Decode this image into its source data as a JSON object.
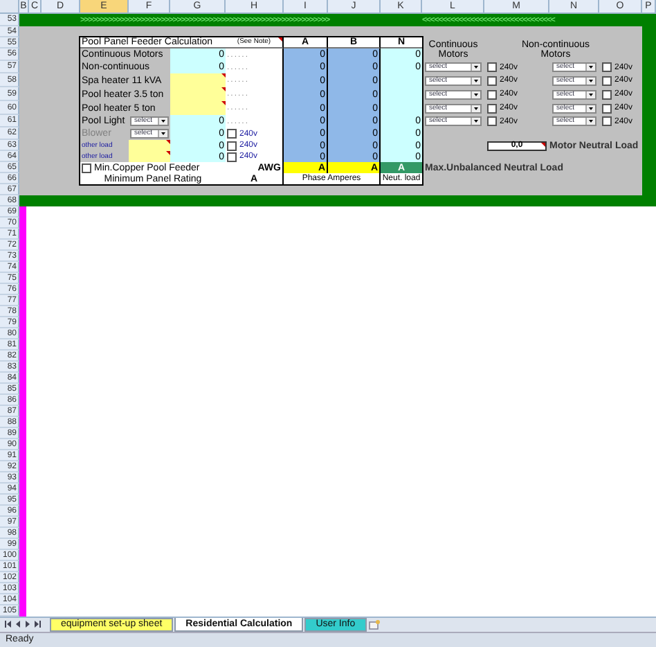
{
  "columns": [
    {
      "label": "B",
      "selected": false
    },
    {
      "label": "C",
      "selected": false
    },
    {
      "label": "D",
      "selected": false
    },
    {
      "label": "E",
      "selected": true
    },
    {
      "label": "F",
      "selected": false
    },
    {
      "label": "G",
      "selected": false
    },
    {
      "label": "H",
      "selected": false
    },
    {
      "label": "I",
      "selected": false
    },
    {
      "label": "J",
      "selected": false
    },
    {
      "label": "K",
      "selected": false
    },
    {
      "label": "L",
      "selected": false
    },
    {
      "label": "M",
      "selected": false
    },
    {
      "label": "N",
      "selected": false
    },
    {
      "label": "O",
      "selected": false
    },
    {
      "label": "P",
      "selected": false
    }
  ],
  "rows": [
    "53",
    "54",
    "55",
    "56",
    "57",
    "58",
    "59",
    "60",
    "61",
    "62",
    "63",
    "64",
    "65",
    "66",
    "67",
    "68",
    "69",
    "70",
    "71",
    "72",
    "73",
    "74",
    "75",
    "76",
    "77",
    "78",
    "79",
    "80",
    "81",
    "82",
    "83",
    "84",
    "85",
    "86",
    "87",
    "88",
    "89",
    "90",
    "91",
    "92",
    "93",
    "94",
    "95",
    "96",
    "97",
    "98",
    "99",
    "100",
    "101",
    "102",
    "103",
    "104",
    "105"
  ],
  "banner": {
    "forward": ">>>>>>>>>>>>>>>>>>>>>>>>>>>>>>>>>>>>>>>>>>>>>>>>>>>>>>>>>>>>>>",
    "back": "<<<<<<<<<<<<<<<<<<<<<<<<<<<<<<<<<"
  },
  "feeder": {
    "title": "Pool Panel Feeder Calculation",
    "note": "(See Note)",
    "headers": [
      "A",
      "B",
      "N"
    ],
    "rows": [
      {
        "kind": "plain",
        "label": "Continuous Motors",
        "value": "0",
        "note": "......",
        "a": "0",
        "b": "0",
        "n": "0"
      },
      {
        "kind": "plain",
        "label": "Non-continuous",
        "value": "0",
        "note": "......",
        "a": "0",
        "b": "0",
        "n": "0"
      },
      {
        "kind": "input",
        "label": "Spa heater 11 kVA",
        "note": "......",
        "a": "0",
        "b": "0"
      },
      {
        "kind": "input",
        "label": "Pool heater 3.5 ton",
        "note": "......",
        "a": "0",
        "b": "0"
      },
      {
        "kind": "input",
        "label": "Pool heater 5 ton",
        "note": "......",
        "a": "0",
        "b": "0"
      },
      {
        "kind": "select",
        "label": "Pool Light",
        "disabled": false,
        "select": "select",
        "value": "0",
        "note": "......",
        "a": "0",
        "b": "0",
        "n": "0"
      },
      {
        "kind": "select",
        "label": "Blower",
        "disabled": true,
        "select": "select",
        "value": "0",
        "check_label": "240v",
        "checked": false,
        "a": "0",
        "b": "0",
        "n": "0"
      },
      {
        "kind": "other",
        "label": "other load",
        "value": "0",
        "check_label": "240v",
        "checked": false,
        "a": "0",
        "b": "0",
        "n": "0"
      },
      {
        "kind": "other",
        "label": "other load",
        "value": "0",
        "check_label": "240v",
        "checked": false,
        "a": "0",
        "b": "0",
        "n": "0"
      }
    ],
    "copper": {
      "label": "Min.Copper Pool Feeder",
      "checked": false
    },
    "awg": "AWG",
    "amp_a": "A",
    "amp_b": "A",
    "amp_n": "A",
    "footer": {
      "rating": "Minimum Panel Rating",
      "rating_unit": "A",
      "phase": "Phase Amperes",
      "neutral": "Neut. load"
    }
  },
  "motors": {
    "groups": [
      {
        "title": "Continuous",
        "subtitle": "Motors",
        "rows": [
          {
            "select": "select",
            "check_label": "240v",
            "checked": false
          },
          {
            "select": "select",
            "check_label": "240v",
            "checked": false
          },
          {
            "select": "select",
            "check_label": "240v",
            "checked": false
          },
          {
            "select": "select",
            "check_label": "240v",
            "checked": false
          },
          {
            "select": "select",
            "check_label": "240v",
            "checked": false
          }
        ]
      },
      {
        "title": "Non-continuous",
        "subtitle": "Motors",
        "rows": [
          {
            "select": "select",
            "check_label": "240v",
            "checked": false
          },
          {
            "select": "select",
            "check_label": "240v",
            "checked": false
          },
          {
            "select": "select",
            "check_label": "240v",
            "checked": false
          },
          {
            "select": "select",
            "check_label": "240v",
            "checked": false
          },
          {
            "select": "select",
            "check_label": "240v",
            "checked": false
          }
        ]
      }
    ],
    "neutral_value": "0,0",
    "neutral_label": "Motor Neutral Load",
    "max_label": "Max.Unbalanced Neutral Load"
  },
  "tabs": [
    {
      "label": "equipment set-up sheet",
      "selected": false,
      "color": "#ffff66"
    },
    {
      "label": "Residential Calculation",
      "selected": true,
      "color": "#ffffff"
    },
    {
      "label": "User Info",
      "selected": false,
      "color": "#33cccc"
    }
  ],
  "status": "Ready"
}
